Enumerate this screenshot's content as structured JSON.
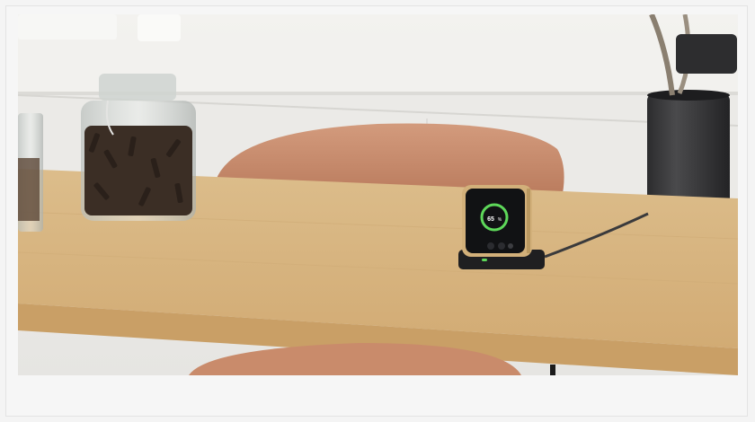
{
  "scene": {
    "device_battery_label": "65",
    "device_battery_unit": "%",
    "colors": {
      "wall": "#ecebe8",
      "counter": "#f1f1ef",
      "cabinet": "#e9e8e5",
      "table_top": "#d9b783",
      "table_edge": "#c9a268",
      "chair": "#c98d6e",
      "vase": "#3c3c3e",
      "jar_glass": "#cfd3d0",
      "jar_content": "#3a2e26",
      "charger": "#222224",
      "phone_gold": "#d2b07a",
      "ring_green": "#5ed85a"
    }
  }
}
